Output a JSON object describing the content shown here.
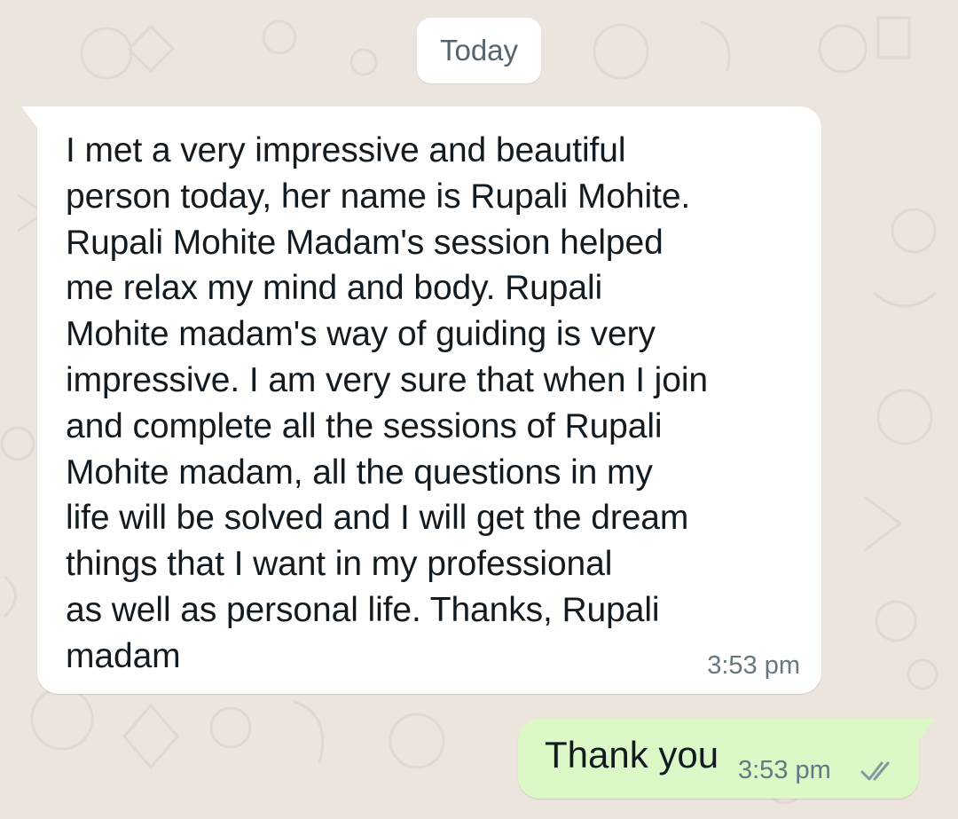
{
  "chat": {
    "date_label": "Today",
    "incoming_message": {
      "text": "I met a very impressive and beautiful\nperson today, her name is Rupali Mohite.\nRupali Mohite Madam's session helped\nme relax my mind and body. Rupali\nMohite madam's way of guiding is very\nimpressive. I am very sure that when I join\nand complete all the sessions of Rupali\nMohite madam, all the questions in my\nlife will be solved and I will get the dream\nthings that I want in my professional\nas well as personal life. Thanks, Rupali\nmadam",
      "time": "3:53 pm"
    },
    "outgoing_message": {
      "text": "Thank you",
      "time": "3:53 pm",
      "status_icon": "double-check-icon"
    }
  },
  "colors": {
    "wallpaper": "#ece5dd",
    "incoming_bubble": "#ffffff",
    "outgoing_bubble": "#dcf8c6",
    "message_text": "#111b21",
    "timestamp": "#667781",
    "ticks": "#8696a0"
  }
}
